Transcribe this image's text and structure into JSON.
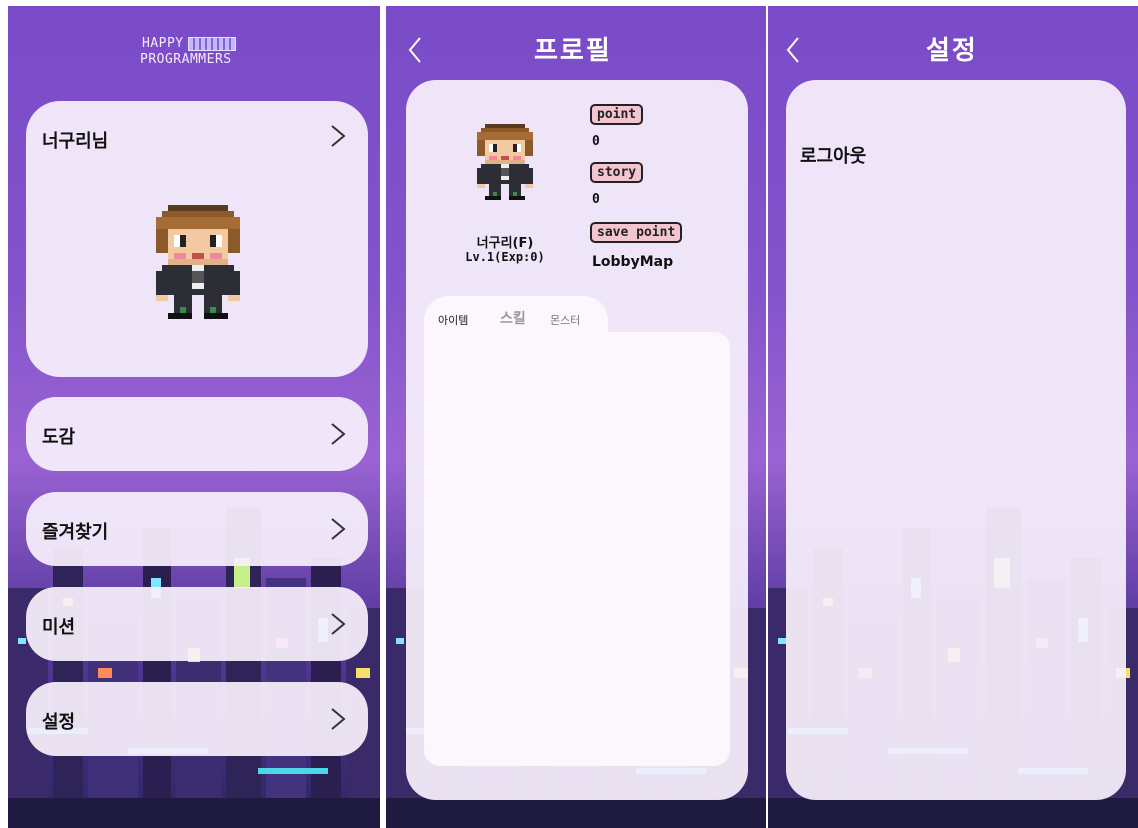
{
  "menu_screen": {
    "logo_line1": "HAPPY",
    "logo_line2": "PROGRAMMERS",
    "profile_label": "너구리님",
    "items": [
      {
        "label": "도감"
      },
      {
        "label": "즐겨찾기"
      },
      {
        "label": "미션"
      },
      {
        "label": "설정"
      }
    ]
  },
  "profile_screen": {
    "title": "프로필",
    "character_name": "너구리(F)",
    "level": "Lv.1(Exp:0)",
    "stats": [
      {
        "label": "point",
        "value": "0"
      },
      {
        "label": "story",
        "value": "0"
      },
      {
        "label": "save point",
        "value": "LobbyMap"
      }
    ],
    "tabs": [
      {
        "label": "아이템",
        "active": true
      },
      {
        "label": "스킬",
        "active": false
      },
      {
        "label": "몬스터",
        "active": false
      }
    ]
  },
  "settings_screen": {
    "title": "설정",
    "logout_label": "로그아웃"
  },
  "colors": {
    "bg_top": "#7a4bc8",
    "card": "#f8f0fc",
    "badge": "#f3c6cf"
  }
}
